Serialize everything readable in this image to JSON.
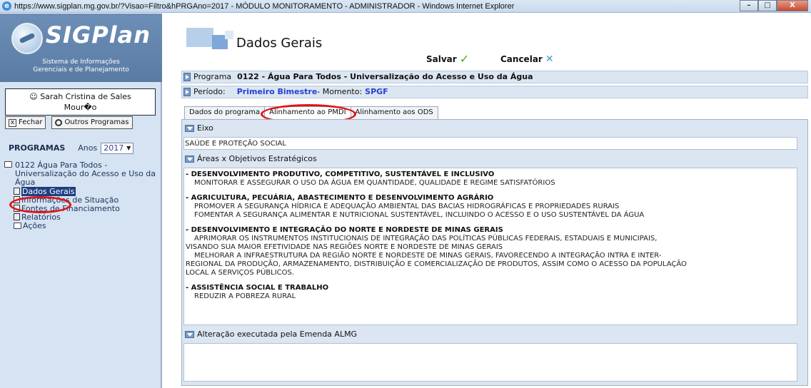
{
  "browser": {
    "title": "https://www.sigplan.mg.gov.br/?Visao=Filtro&hPRGAno=2017 - MÓDULO MONITORAMENTO - ADMINISTRADOR - Windows Internet Explorer",
    "icon": "ie-icon",
    "buttons": [
      "–",
      "□",
      "X"
    ]
  },
  "sidebar": {
    "logo_text": "SIGPlan",
    "logo_sub": [
      "Sistema de Informações",
      "Gerenciais e de Planejamento"
    ],
    "user": [
      "Sarah Cristina de Sales",
      "Mour�o"
    ],
    "close_label": "Fechar",
    "other_programs_label": "Outros Programas",
    "programs_label": "PROGRAMAS",
    "years_label": "Anos",
    "year_value": "2017",
    "tree_root": "0122 Água Para Todos - Universalização do Acesso e Uso da Água",
    "tree_items": [
      "Dados Gerais",
      "Informações de Situação",
      "Fontes de Financiamento",
      "Relatórios",
      "Ações"
    ]
  },
  "main": {
    "title": "Dados Gerais",
    "save_label": "Salvar",
    "cancel_label": "Cancelar",
    "program_label": "Programa",
    "program_value": "0122 - Água Para Todos - Universalização do Acesso e Uso da Água",
    "period_label": "Período:",
    "period_value": "Primeiro Bimestre",
    "moment_sep": " - Momento:",
    "moment_value": "SPGF",
    "tabs": [
      "Dados do programa",
      "Alinhamento ao PMDI",
      "Alinhamento aos ODS"
    ],
    "eixo_label": "Eixo",
    "eixo_value": "SAÚDE E PROTEÇÃO SOCIAL",
    "areas_label": "Áreas x Objetivos Estratégicos",
    "groups": [
      {
        "title": "- DESENVOLVIMENTO PRODUTIVO, COMPETITIVO, SUSTENTÁVEL E INCLUSIVO",
        "lines": [
          "MONITORAR E ASSEGURAR O USO DA ÁGUA EM QUANTIDADE, QUALIDADE E REGIME SATISFATÓRIOS"
        ]
      },
      {
        "title": "- AGRICULTURA, PECUÁRIA, ABASTECIMENTO E DESENVOLVIMENTO AGRÁRIO",
        "lines": [
          "PROMOVER A SEGURANÇA HÍDRICA E ADEQUAÇÃO AMBIENTAL DAS BACIAS HIDROGRÁFICAS E PROPRIEDADES RURAIS",
          "FOMENTAR A SEGURANÇA ALIMENTAR E NUTRICIONAL SUSTENTÁVEL, INCLUINDO O ACESSO E O USO SUSTENTÁVEL DA ÁGUA"
        ]
      },
      {
        "title": "- DESENVOLVIMENTO E INTEGRAÇÃO DO NORTE E NORDESTE DE MINAS GERAIS",
        "lines": [
          "APRIMORAR OS INSTRUMENTOS INSTITUCIONAIS DE INTEGRAÇÃO DAS POLÍTICAS PÚBLICAS FEDERAIS, ESTADUAIS E MUNICIPAIS,",
          "VISANDO SUA MAIOR EFETIVIDADE NAS REGIÕES NORTE E NORDESTE DE MINAS GERAIS",
          "MELHORAR A INFRAESTRUTURA DA REGIÃO NORTE E NORDESTE DE MINAS GERAIS, FAVORECENDO A INTEGRAÇÃO INTRA E INTER-",
          "REGIONAL DA PRODUÇÃO, ARMAZENAMENTO, DISTRIBUIÇÃO E COMERCIALIZAÇÃO DE PRODUTOS, ASSIM COMO O ACESSO DA POPULAÇÃO",
          "LOCAL A SERVIÇOS PÚBLICOS."
        ]
      },
      {
        "title": "- ASSISTÊNCIA SOCIAL E TRABALHO",
        "lines": [
          "REDUZIR A POBREZA RURAL"
        ]
      }
    ],
    "emenda_label": "Alteração executada pela Emenda ALMG"
  }
}
